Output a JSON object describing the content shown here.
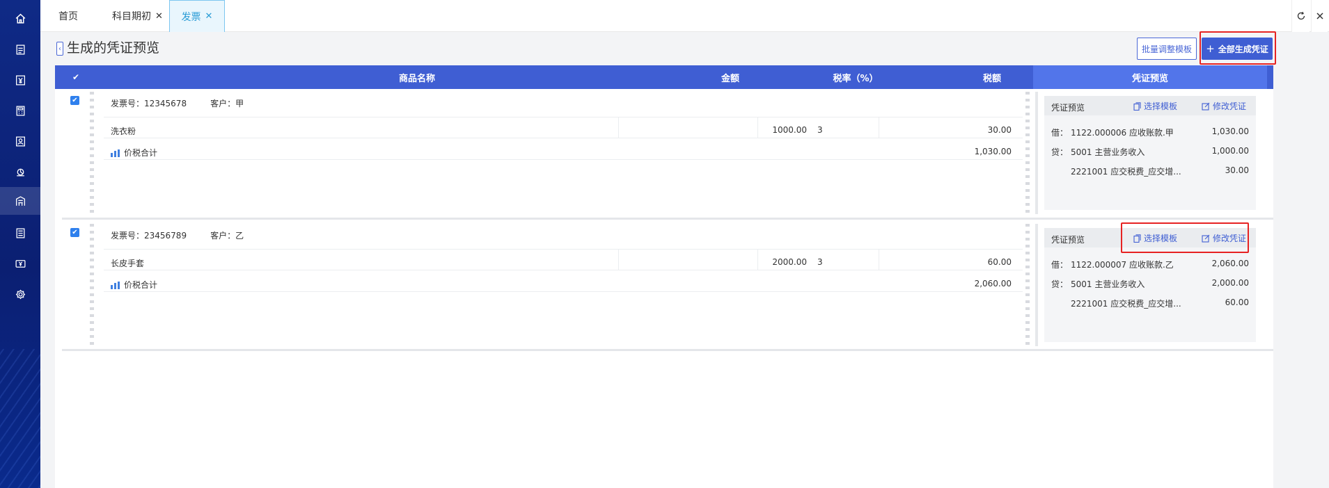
{
  "tabs": [
    {
      "label": "首页",
      "closable": false
    },
    {
      "label": "科目期初",
      "closable": true
    },
    {
      "label": "发票",
      "closable": true,
      "active": true
    }
  ],
  "sidebar_icons": [
    "home-icon",
    "document-icon",
    "yen-icon",
    "calculator-icon",
    "ledger-icon",
    "chart-icon",
    "building-icon",
    "report-icon",
    "money-icon",
    "settings-icon"
  ],
  "page": {
    "title": "生成的凭证预览",
    "batch_button": "批量调整模板",
    "generate_all_button": "全部生成凭证"
  },
  "table_header": {
    "product_name": "商品名称",
    "amount": "金额",
    "tax_rate": "税率（%）",
    "tax": "税额",
    "voucher_preview": "凭证预览"
  },
  "invoices": [
    {
      "checked": true,
      "invoice_no": "发票号：12345678",
      "customer": "客户：甲",
      "items": [
        {
          "name": "洗衣粉",
          "amount": "1000.00",
          "rate": "3",
          "tax": "30.00"
        }
      ],
      "total_label": "价税合计",
      "total": "1,030.00",
      "voucher": {
        "title": "凭证预览",
        "select_template": "选择模板",
        "edit_voucher": "修改凭证",
        "entries": [
          {
            "dc": "借：",
            "account": "1122.000006 应收账款.甲",
            "amount": "1,030.00"
          },
          {
            "dc": "贷：",
            "account": "5001 主营业务收入",
            "amount": "1,000.00"
          },
          {
            "dc": "",
            "account": "2221001 应交税费_应交增...",
            "amount": "30.00"
          }
        ]
      }
    },
    {
      "checked": true,
      "invoice_no": "发票号：23456789",
      "customer": "客户：乙",
      "items": [
        {
          "name": "长皮手套",
          "amount": "2000.00",
          "rate": "3",
          "tax": "60.00"
        }
      ],
      "total_label": "价税合计",
      "total": "2,060.00",
      "voucher": {
        "title": "凭证预览",
        "select_template": "选择模板",
        "edit_voucher": "修改凭证",
        "entries": [
          {
            "dc": "借：",
            "account": "1122.000007 应收账款.乙",
            "amount": "2,060.00"
          },
          {
            "dc": "贷：",
            "account": "5001 主营业务收入",
            "amount": "2,000.00"
          },
          {
            "dc": "",
            "account": "2221001 应交税费_应交增...",
            "amount": "60.00"
          }
        ]
      }
    }
  ],
  "colors": {
    "sidebar": "#0f2a86",
    "primary": "#3f5ed3",
    "header_preview": "#5275ea",
    "highlight": "#e62222",
    "active_tab": "#2a9cd6"
  }
}
